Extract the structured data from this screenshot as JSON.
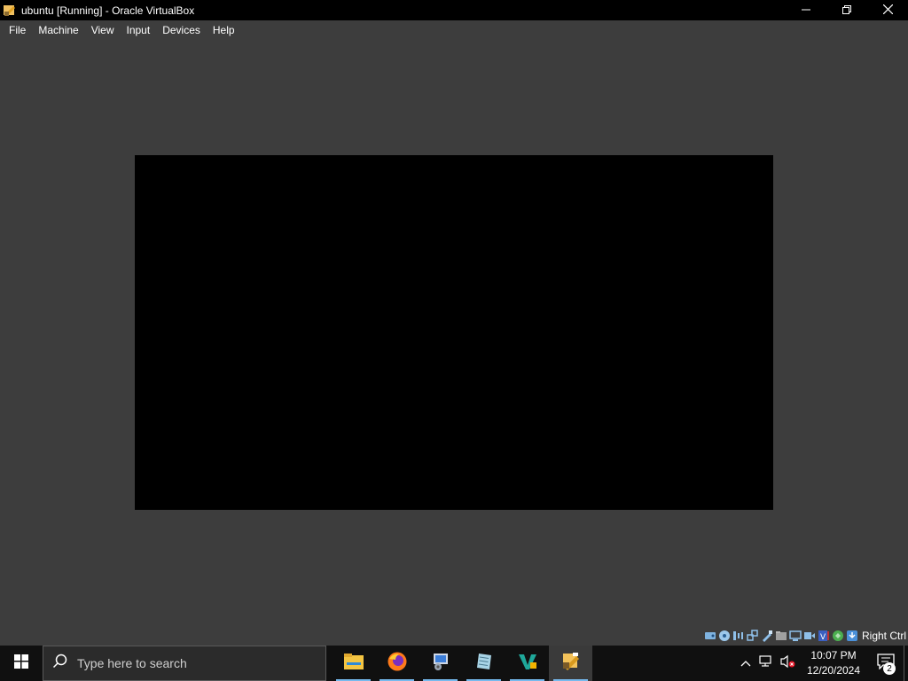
{
  "window": {
    "title": "ubuntu [Running] - Oracle VirtualBox",
    "controls": [
      "minimize-icon",
      "restore-icon",
      "close-icon"
    ]
  },
  "menu": {
    "items": [
      {
        "label": "File"
      },
      {
        "label": "Machine"
      },
      {
        "label": "View"
      },
      {
        "label": "Input"
      },
      {
        "label": "Devices"
      },
      {
        "label": "Help"
      }
    ]
  },
  "statusbar": {
    "icons": [
      "hard-disk-icon",
      "optical-drive-icon",
      "audio-icon",
      "network-icon",
      "usb-icon",
      "shared-folders-icon",
      "display-icon",
      "recording-icon",
      "cpu-virtualization-icon",
      "mouse-integration-icon",
      "keyboard-capture-icon"
    ],
    "host_key": "Right Ctrl"
  },
  "taskbar": {
    "search_placeholder": "Type here to search",
    "apps": [
      {
        "name": "file-explorer",
        "active": false
      },
      {
        "name": "firefox",
        "active": false
      },
      {
        "name": "control-panel",
        "active": false
      },
      {
        "name": "notepad",
        "active": false
      },
      {
        "name": "vscode",
        "active": false
      },
      {
        "name": "virtualbox",
        "active": true
      }
    ],
    "clock": {
      "time": "10:07 PM",
      "date": "12/20/2024"
    },
    "notification_count": "2"
  },
  "colors": {
    "titlebar": "#000000",
    "chrome": "#3d3d3d",
    "vm_screen": "#000000",
    "taskbar": "#101010",
    "accent": "#76b9ed"
  }
}
